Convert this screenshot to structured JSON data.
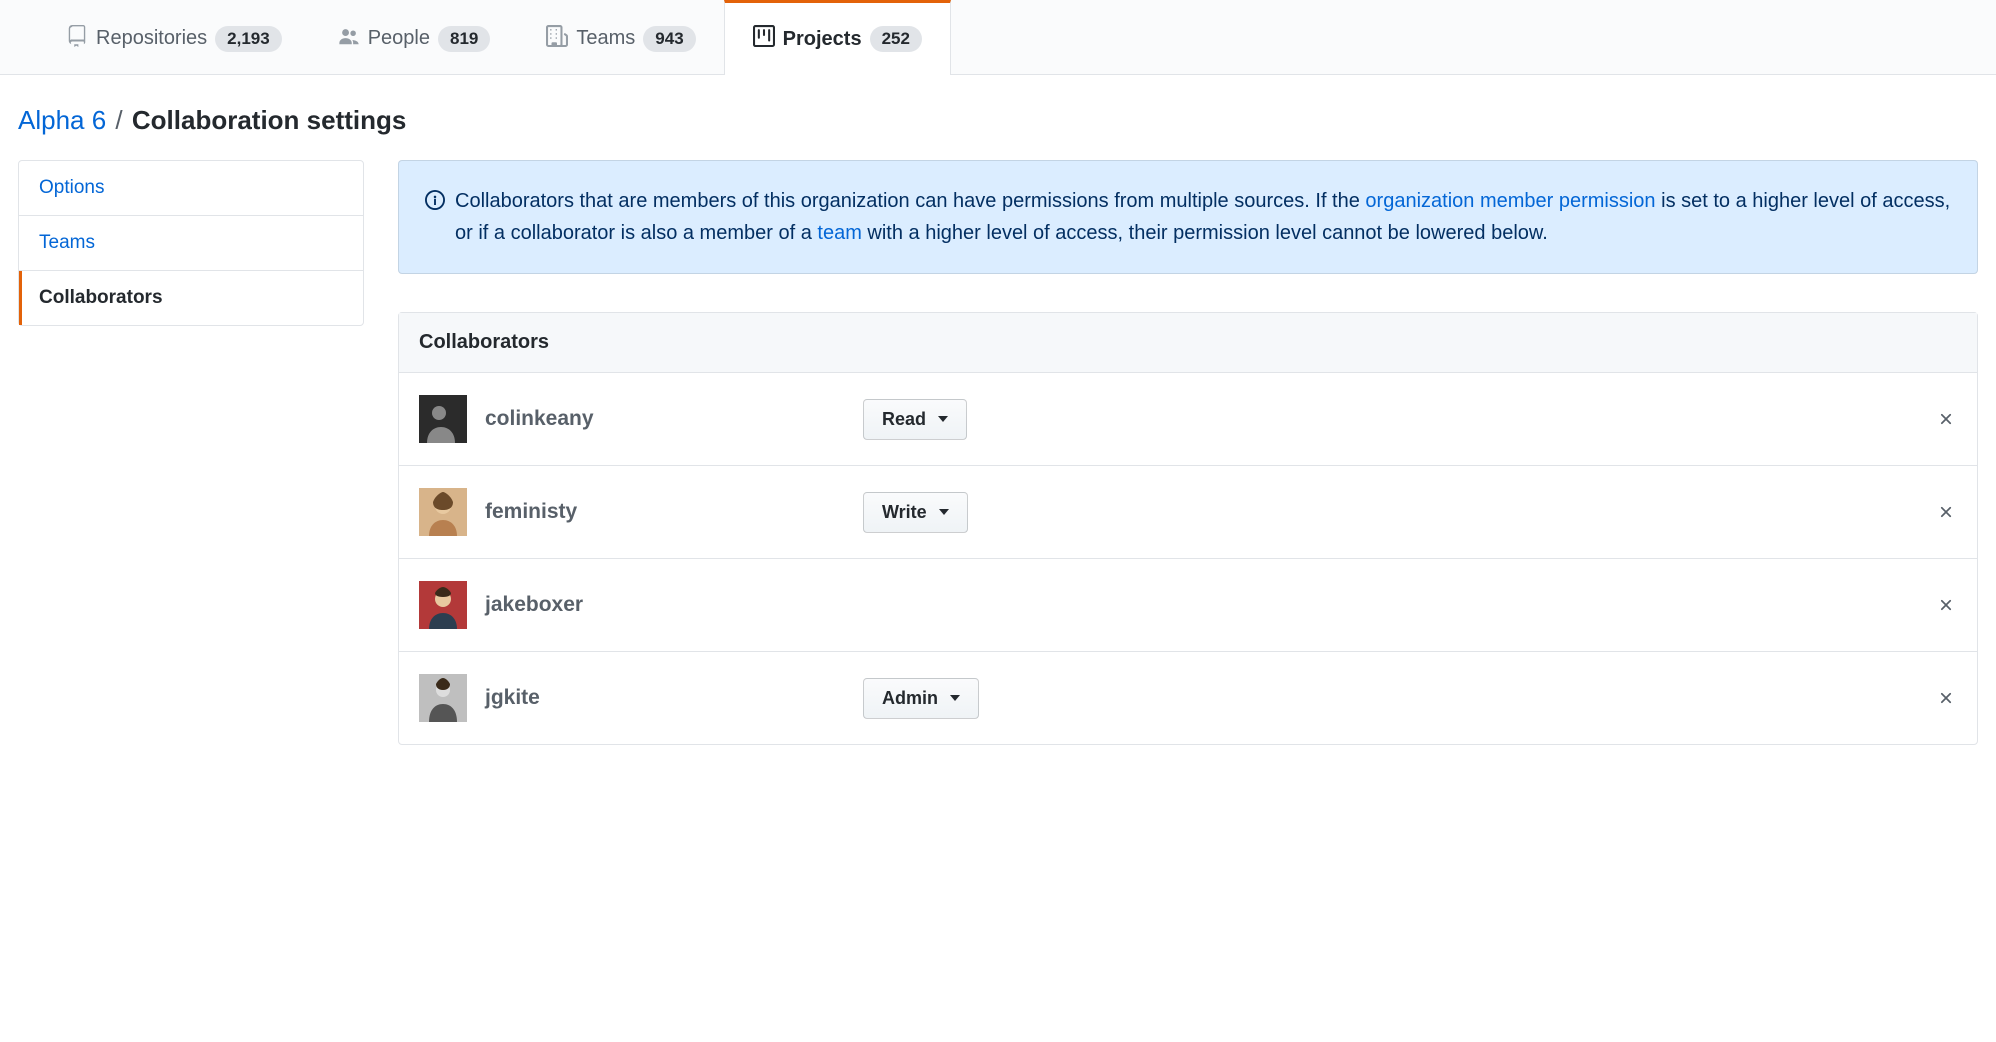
{
  "nav": {
    "tabs": [
      {
        "label": "Repositories",
        "count": "2,193"
      },
      {
        "label": "People",
        "count": "819"
      },
      {
        "label": "Teams",
        "count": "943"
      },
      {
        "label": "Projects",
        "count": "252"
      }
    ]
  },
  "breadcrumb": {
    "project": "Alpha 6",
    "current": "Collaboration settings"
  },
  "sidebar": {
    "items": [
      {
        "label": "Options"
      },
      {
        "label": "Teams"
      },
      {
        "label": "Collaborators"
      }
    ]
  },
  "flash": {
    "text_before_link1": "Collaborators that are members of this organization can have permissions from multiple sources. If the ",
    "link1": "organization member permission",
    "text_between": " is set to a higher level of access, or if a collaborator is also a member of a ",
    "link2": "team",
    "text_after": " with a higher level of access, their permission level cannot be lowered below."
  },
  "box": {
    "header": "Collaborators",
    "rows": [
      {
        "username": "colinkeany",
        "permission": "Read"
      },
      {
        "username": "feministy",
        "permission": "Write"
      },
      {
        "username": "jakeboxer",
        "permission": ""
      },
      {
        "username": "jgkite",
        "permission": "Admin"
      }
    ]
  }
}
